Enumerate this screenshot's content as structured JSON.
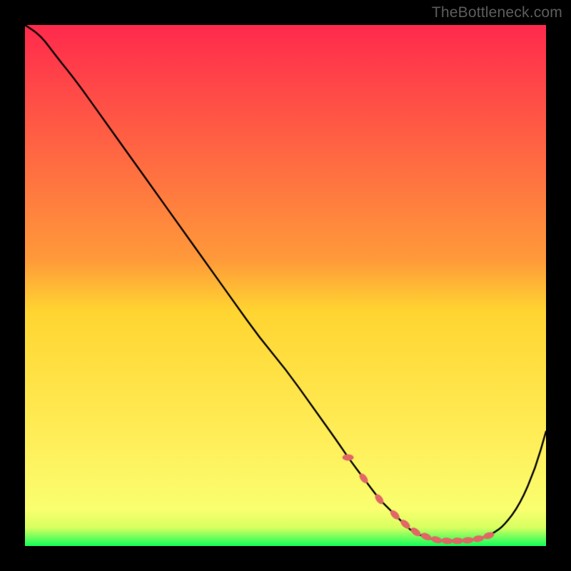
{
  "attribution": "TheBottleneck.com",
  "colors": {
    "frame_bg": "#000000",
    "gradient_top": "#ff2a4d",
    "gradient_mid": "#ffd531",
    "gradient_low": "#faff70",
    "gradient_bottom": "#12ff5a",
    "curve": "#000000",
    "marker": "#e06765"
  },
  "chart_data": {
    "type": "line",
    "title": "",
    "xlabel": "",
    "ylabel": "",
    "xlim": [
      0,
      100
    ],
    "ylim": [
      0,
      100
    ],
    "series": [
      {
        "name": "bottleneck-curve",
        "x": [
          0,
          3,
          6,
          10,
          15,
          20,
          25,
          30,
          35,
          40,
          45,
          50,
          55,
          60,
          62,
          65,
          68,
          70,
          72,
          74,
          76,
          78,
          80,
          82,
          84,
          86,
          88,
          90,
          92,
          95,
          98,
          100
        ],
        "y": [
          100,
          98,
          94,
          89,
          82,
          75,
          68,
          61,
          54,
          47,
          40,
          34,
          27,
          20,
          17,
          13,
          9,
          7,
          5,
          3,
          2,
          1.3,
          1,
          1,
          1,
          1.2,
          1.6,
          2.5,
          4,
          8,
          15,
          22
        ]
      }
    ],
    "markers": {
      "name": "highlight-band",
      "x": [
        62,
        65,
        68,
        71,
        73,
        75,
        77,
        79,
        81,
        83,
        85,
        87,
        89
      ],
      "y": [
        17,
        13,
        9,
        6,
        4.2,
        2.7,
        1.8,
        1.2,
        1,
        1,
        1.1,
        1.4,
        2.0
      ]
    }
  }
}
